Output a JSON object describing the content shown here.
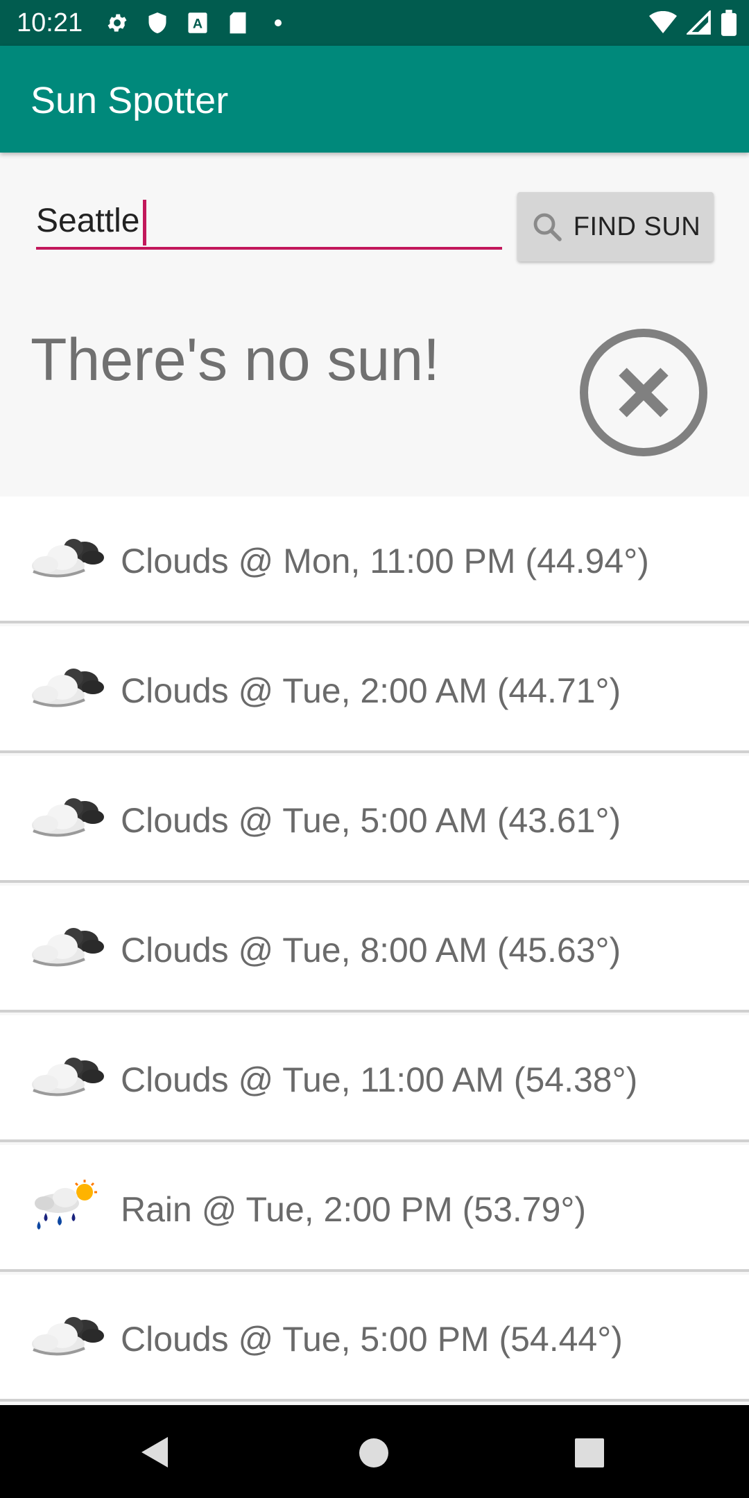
{
  "status_bar": {
    "time": "10:21"
  },
  "app_bar": {
    "title": "Sun Spotter"
  },
  "search": {
    "value": "Seattle",
    "button_label": "FIND SUN"
  },
  "result": {
    "message": "There's no sun!"
  },
  "forecast": [
    {
      "icon": "clouds",
      "label": "Clouds @ Mon, 11:00 PM (44.94°)"
    },
    {
      "icon": "clouds",
      "label": "Clouds @ Tue, 2:00 AM (44.71°)"
    },
    {
      "icon": "clouds",
      "label": "Clouds @ Tue, 5:00 AM (43.61°)"
    },
    {
      "icon": "clouds",
      "label": "Clouds @ Tue, 8:00 AM (45.63°)"
    },
    {
      "icon": "clouds",
      "label": "Clouds @ Tue, 11:00 AM (54.38°)"
    },
    {
      "icon": "rain",
      "label": "Rain @ Tue, 2:00 PM (53.79°)"
    },
    {
      "icon": "clouds",
      "label": "Clouds @ Tue, 5:00 PM (54.44°)"
    }
  ],
  "colors": {
    "status_bar": "#015c4f",
    "app_bar": "#00897b",
    "accent": "#c2185b"
  }
}
